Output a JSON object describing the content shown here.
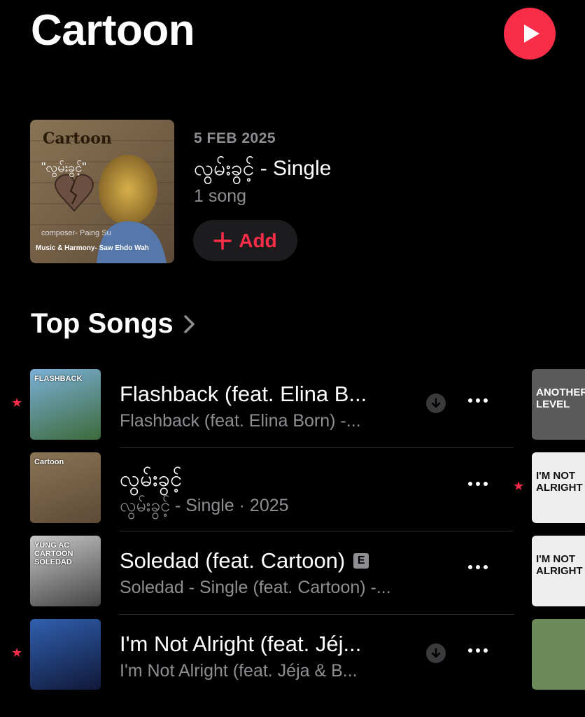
{
  "header": {
    "title": "Cartoon"
  },
  "latest_release": {
    "date": "5 FEB 2025",
    "title": "လွမ်းခွင့် - Single",
    "count": "1 song",
    "add_label": "Add",
    "art_text": {
      "artist": "Cartoon",
      "song": "\"လွမ်းခွင့်\"",
      "composer": "composer- Paing Su",
      "credits": "Music & Harmony- Saw Ehdo Wah"
    }
  },
  "top_songs": {
    "heading": "Top Songs",
    "items": [
      {
        "title": "Flashback (feat. Elina B...",
        "subtitle": "Flashback (feat. Elina Born) -...",
        "starred": true,
        "downloaded": true,
        "explicit": false,
        "art_label": "FLASHBACK",
        "next_art_label": "ANOTHER LEVEL",
        "next_starred": false
      },
      {
        "title": "လွမ်းခွင့်",
        "subtitle": "လွမ်းခွင့် - Single · 2025",
        "starred": false,
        "downloaded": false,
        "explicit": false,
        "art_label": "Cartoon",
        "next_art_label": "I'M NOT ALRIGHT",
        "next_starred": true
      },
      {
        "title": "Soledad (feat. Cartoon)",
        "subtitle": "Soledad - Single (feat. Cartoon) -...",
        "starred": false,
        "downloaded": false,
        "explicit": true,
        "explicit_label": "E",
        "art_label": "YUNG AC CARTOON SOLEDAD",
        "next_art_label": "I'M NOT ALRIGHT",
        "next_starred": false
      },
      {
        "title": "I'm Not Alright (feat. Jéj...",
        "subtitle": "I'm Not Alright (feat. Jéja & B...",
        "starred": true,
        "downloaded": true,
        "explicit": false,
        "art_label": "",
        "next_art_label": "",
        "next_starred": false
      }
    ]
  },
  "colors": {
    "accent": "#fa2d48",
    "secondary_text": "#8e8e93",
    "background": "#000000"
  }
}
